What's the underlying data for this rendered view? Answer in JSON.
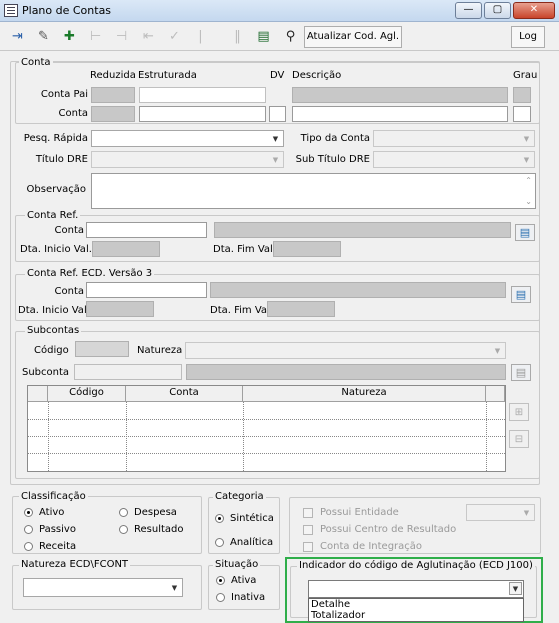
{
  "window": {
    "title": "Plano de Contas",
    "min": "—",
    "max": "▢",
    "close": "✕"
  },
  "toolbar": {
    "atualizar": "Atualizar Cod. Agl.",
    "log": "Log"
  },
  "conta": {
    "legend": "Conta",
    "h_reduzida": "Reduzida",
    "h_estruturada": "Estruturada",
    "h_dv": "DV",
    "h_descricao": "Descrição",
    "h_grau": "Grau",
    "conta_pai": "Conta Pai",
    "conta": "Conta"
  },
  "fields": {
    "pesq": "Pesq. Rápida",
    "tipo": "Tipo da Conta",
    "titulo_dre": "Título DRE",
    "sub_titulo_dre": "Sub Título DRE",
    "observacao": "Observação"
  },
  "conta_ref": {
    "legend": "Conta Ref.",
    "conta": "Conta",
    "dta_inicio": "Dta. Inicio Val.",
    "dta_fim": "Dta. Fim Val."
  },
  "conta_ref_ecd": {
    "legend": "Conta Ref. ECD. Versão 3",
    "conta": "Conta",
    "dta_inicio": "Dta. Inicio Val",
    "dta_fim": "Dta. Fim Val"
  },
  "subcontas": {
    "legend": "Subcontas",
    "codigo": "Código",
    "natureza": "Natureza",
    "subconta": "Subconta",
    "columns": [
      "Código",
      "Conta",
      "Natureza"
    ]
  },
  "classificacao": {
    "legend": "Classificação",
    "ativo": "Ativo",
    "despesa": "Despesa",
    "passivo": "Passivo",
    "resultado": "Resultado",
    "receita": "Receita"
  },
  "categoria": {
    "legend": "Categoria",
    "sintetica": "Sintética",
    "analitica": "Analítica"
  },
  "options": {
    "possui_entidade": "Possui Entidade",
    "possui_centro": "Possui Centro de Resultado",
    "conta_integracao": "Conta de Integração"
  },
  "natureza_ecd": {
    "legend": "Natureza ECD\\FCONT"
  },
  "situacao": {
    "legend": "Situação",
    "ativa": "Ativa",
    "inativa": "Inativa"
  },
  "indicador": {
    "legend": "Indicador do código de Aglutinação (ECD J100)",
    "options": [
      "Detalhe",
      "Totalizador"
    ]
  }
}
